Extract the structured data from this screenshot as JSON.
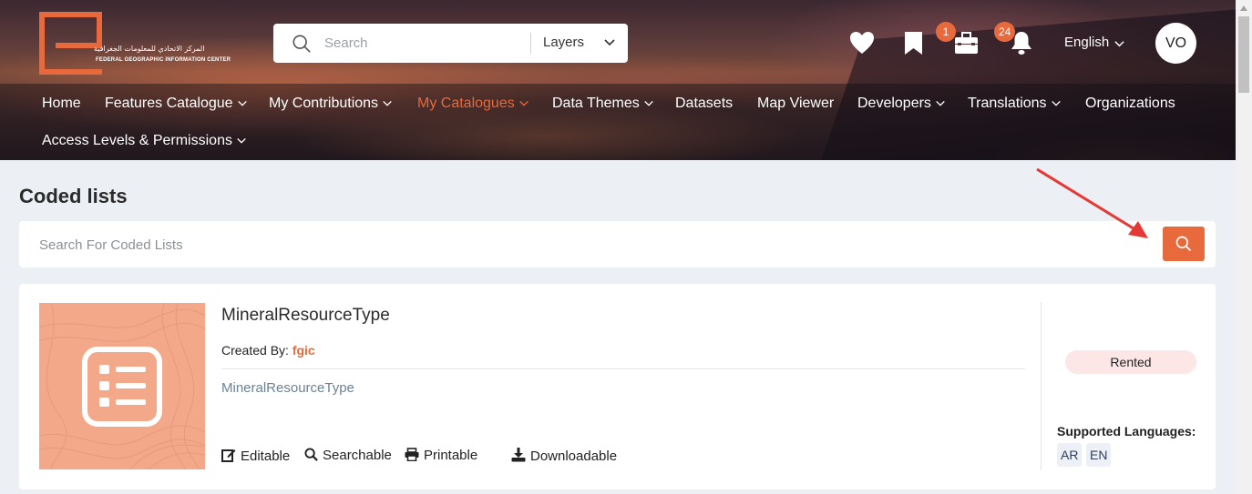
{
  "header": {
    "logo": {
      "arabic_text": "المركز الاتحادي للمعلومات الجغرافية",
      "english_text": "FEDERAL GEOGRAPHIC INFORMATION CENTER"
    },
    "search": {
      "placeholder": "Search",
      "scope": "Layers"
    },
    "icons": {
      "favorites": "heart-icon",
      "bookmarks": "bookmark-icon",
      "toolbox": "briefcase-icon",
      "notifications": "bell-icon"
    },
    "toolbox_badge": "1",
    "notifications_badge": "24",
    "language": "English",
    "avatar_initials": "VO"
  },
  "nav": {
    "items": [
      {
        "label": "Home",
        "dropdown": false
      },
      {
        "label": "Features Catalogue",
        "dropdown": true
      },
      {
        "label": "My Contributions",
        "dropdown": true
      },
      {
        "label": "My Catalogues",
        "dropdown": true,
        "active": true
      },
      {
        "label": "Data Themes",
        "dropdown": true
      },
      {
        "label": "Datasets",
        "dropdown": false
      },
      {
        "label": "Map Viewer",
        "dropdown": false
      },
      {
        "label": "Developers",
        "dropdown": true
      },
      {
        "label": "Translations",
        "dropdown": true
      },
      {
        "label": "Organizations",
        "dropdown": false
      },
      {
        "label": "Access Levels & Permissions",
        "dropdown": true
      }
    ]
  },
  "page": {
    "title": "Coded lists",
    "search_placeholder": "Search For Coded Lists"
  },
  "cards": [
    {
      "title": "MineralResourceType",
      "created_by_label": "Created By:",
      "author": "fgic",
      "description": "MineralResourceType",
      "features": [
        "Editable",
        "Searchable",
        "Printable",
        "Downloadable"
      ],
      "status": "Rented",
      "supported_languages_label": "Supported Languages:",
      "languages": [
        "AR",
        "EN"
      ]
    }
  ],
  "colors": {
    "accent": "#e8693b",
    "thumbnail_bg": "#f2a889",
    "rented_bg": "#fde6e6",
    "annotation_arrow": "#e53935"
  }
}
